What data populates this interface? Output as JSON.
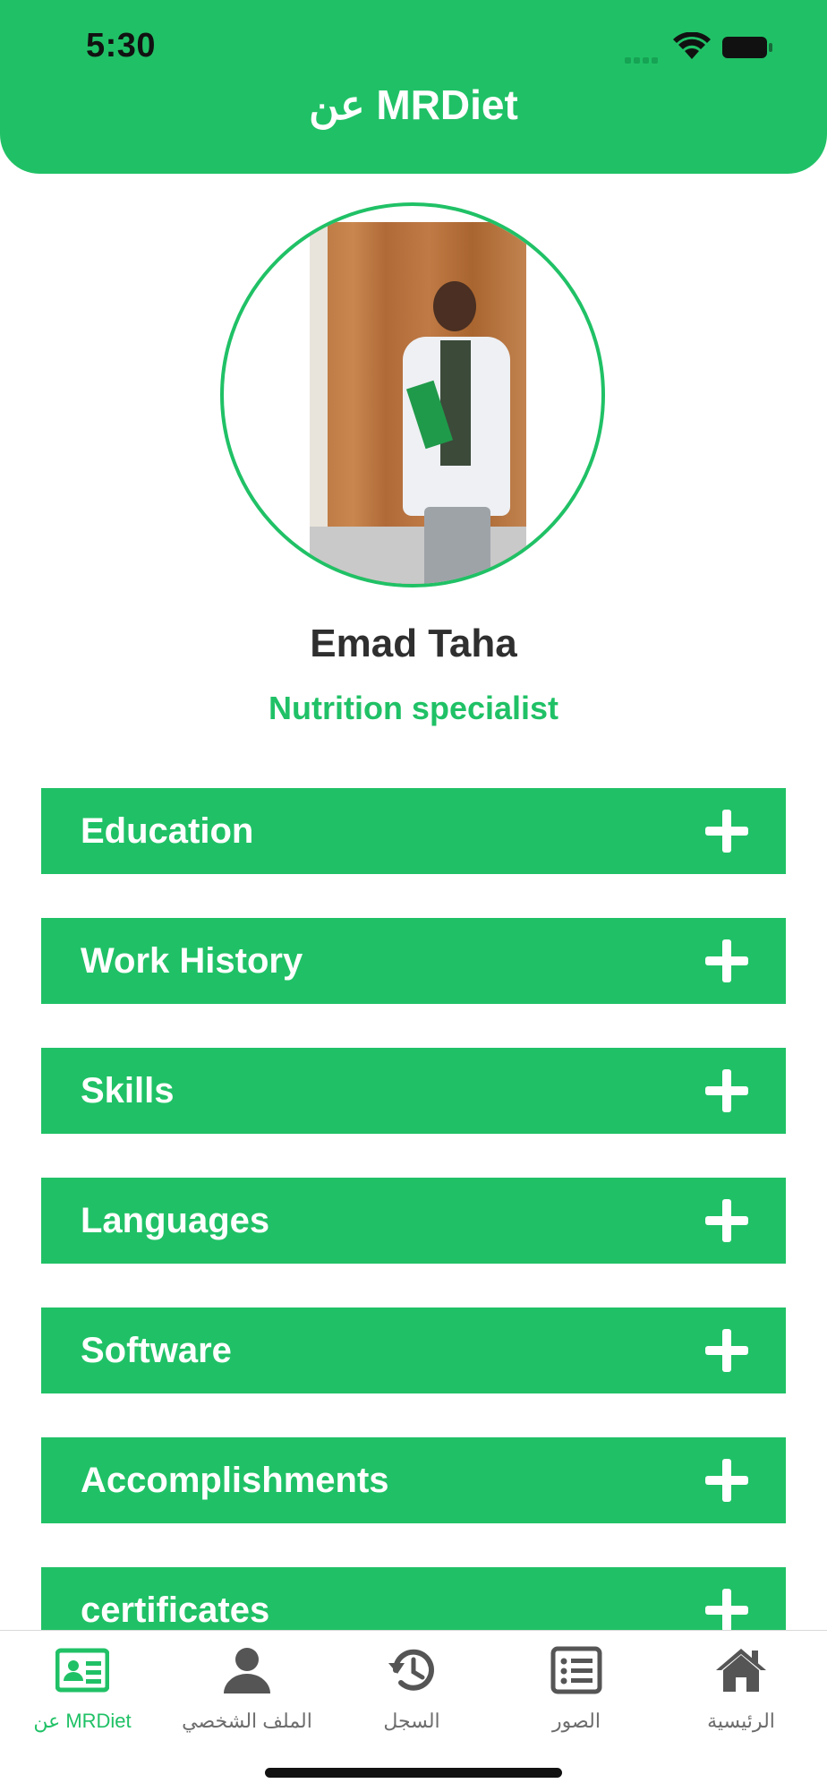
{
  "status_bar": {
    "time": "5:30"
  },
  "header": {
    "title": "عن MRDiet"
  },
  "profile": {
    "name": "Emad Taha",
    "role": "Nutrition specialist"
  },
  "sections": [
    {
      "title": "Education"
    },
    {
      "title": "Work History"
    },
    {
      "title": "Skills"
    },
    {
      "title": "Languages"
    },
    {
      "title": "Software"
    },
    {
      "title": "Accomplishments"
    },
    {
      "title": "certificates"
    }
  ],
  "tabbar": {
    "items": [
      {
        "label": "عن MRDiet",
        "icon": "id-card-icon",
        "active": true
      },
      {
        "label": "الملف الشخصي",
        "icon": "user-icon",
        "active": false
      },
      {
        "label": "السجل",
        "icon": "history-icon",
        "active": false
      },
      {
        "label": "الصور",
        "icon": "list-icon",
        "active": false
      },
      {
        "label": "الرئيسية",
        "icon": "home-icon",
        "active": false
      }
    ]
  },
  "colors": {
    "accent": "#20C166",
    "inactive": "#6d6d6d"
  }
}
